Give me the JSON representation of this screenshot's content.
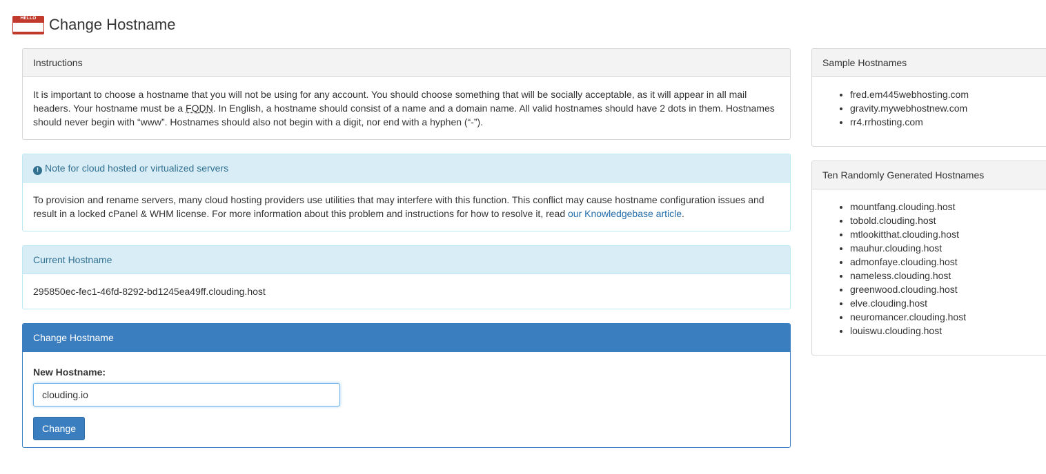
{
  "header": {
    "icon_text": "HELLO",
    "title": "Change Hostname"
  },
  "instructions": {
    "heading": "Instructions",
    "text_part1": "It is important to choose a hostname that you will not be using for any account. You should choose something that will be socially acceptable, as it will appear in all mail headers. Your hostname must be a ",
    "fqdn": "FQDN",
    "text_part2": ". In English, a hostname should consist of a name and a domain name. All valid hostnames should have 2 dots in them. Hostnames should never begin with “www”. Hostnames should also not begin with a digit, nor end with a hyphen (“-”)."
  },
  "note": {
    "heading": "Note for cloud hosted or virtualized servers",
    "icon": "exclamation-circle-icon",
    "text": "To provision and rename servers, many cloud hosting providers use utilities that may interfere with this function. This conflict may cause hostname configuration issues and result in a locked cPanel & WHM license. For more information about this problem and instructions for how to resolve it, read ",
    "link_text": "our Knowledgebase article",
    "text_end": "."
  },
  "current": {
    "heading": "Current Hostname",
    "value": "295850ec-fec1-46fd-8292-bd1245ea49ff.clouding.host"
  },
  "change": {
    "heading": "Change Hostname",
    "label": "New Hostname:",
    "input_value": "clouding.io",
    "button_label": "Change"
  },
  "samples": {
    "heading": "Sample Hostnames",
    "items": [
      "fred.em445webhosting.com",
      "gravity.mywebhostnew.com",
      "rr4.rrhosting.com"
    ]
  },
  "random": {
    "heading": "Ten Randomly Generated Hostnames",
    "items": [
      "mountfang.clouding.host",
      "tobold.clouding.host",
      "mtlookitthat.clouding.host",
      "mauhur.clouding.host",
      "admonfaye.clouding.host",
      "nameless.clouding.host",
      "greenwood.clouding.host",
      "elve.clouding.host",
      "neuromancer.clouding.host",
      "louiswu.clouding.host"
    ]
  },
  "colors": {
    "primary": "#3a7ebf",
    "info_bg": "#d9edf7",
    "info_text": "#31708f",
    "link": "#1f6aa8",
    "icon_red": "#c0392b"
  }
}
